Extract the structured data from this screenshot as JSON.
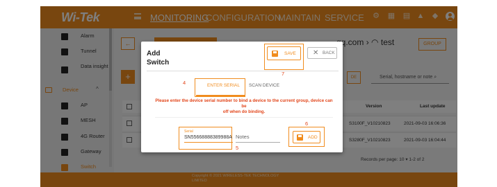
{
  "header": {
    "logo": "Wi-Tek",
    "nav": [
      "MONITORING",
      "CONFIGURATION",
      "MAINTAIN",
      "SERVICE"
    ]
  },
  "sidebar": {
    "items": [
      {
        "label": "Alarm",
        "icon": "bell-icon"
      },
      {
        "label": "Tunnel",
        "icon": "tunnel-icon"
      },
      {
        "label": "Data insight",
        "icon": "chart-icon"
      }
    ],
    "device_label": "Device",
    "device_items": [
      {
        "label": "AP",
        "icon": "ap-icon"
      },
      {
        "label": "MESH",
        "icon": "mesh-icon"
      },
      {
        "label": "4G Router",
        "icon": "router-icon"
      },
      {
        "label": "Gateway",
        "icon": "gateway-icon"
      },
      {
        "label": "Switch",
        "icon": "switch-icon"
      }
    ]
  },
  "main": {
    "breadcrumb_suffix": "qq.com",
    "breadcrumb_site": "test",
    "group_button": "GROUP",
    "plus_button": "+",
    "de_button": "DE",
    "search_placeholder": "Serial, hostname or note",
    "columns": {
      "version": "Version",
      "last_update": "Last update"
    },
    "rows": [
      {
        "version": "S3100F_V10210823",
        "last_update": "2021-09-03 16:06:36"
      },
      {
        "version": "S3280F_V10210823",
        "last_update": "2021-09-03 16:04:44"
      }
    ],
    "pager": {
      "records_label": "Records per page:",
      "per_page": "10",
      "range": "1-2 of 2"
    }
  },
  "footer": {
    "line1": "Copyright © 2021 WIRELESS-TEK TECHNOLOGY",
    "line2": "LIMITED"
  },
  "modal": {
    "title_line1": "Add",
    "title_line2": "Switch",
    "save_label": "SAVE",
    "back_label": "BACK",
    "tabs": [
      "ENTER SERIAL",
      "SCAN DEVICE"
    ],
    "warning_line1": "Please enter the device serial number to bind a device to the current group, device can be",
    "warning_line2": "off when do binding.",
    "serial_label": "Serial",
    "serial_value": "SN55668888389988A",
    "notes_label": "Notes",
    "add_label": "ADD",
    "annotations": [
      "4",
      "5",
      "6",
      "7"
    ]
  },
  "colors": {
    "accent": "#f08c1e",
    "warning": "#e2461b"
  }
}
